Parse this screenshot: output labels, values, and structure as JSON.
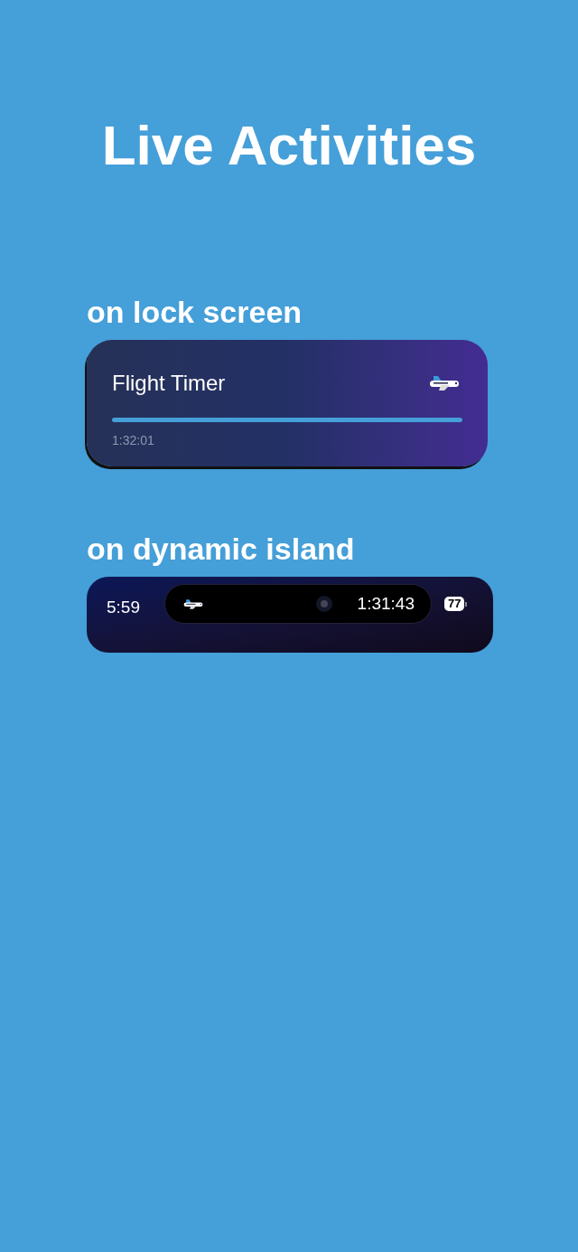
{
  "title": "Live Activities",
  "lock_screen": {
    "heading": "on lock screen",
    "activity": {
      "title": "Flight Timer",
      "level": 1,
      "time": "1:32:01"
    }
  },
  "dynamic_island": {
    "heading": "on dynamic island",
    "clock": "5:59",
    "timer": "1:31:43",
    "battery": "77"
  }
}
